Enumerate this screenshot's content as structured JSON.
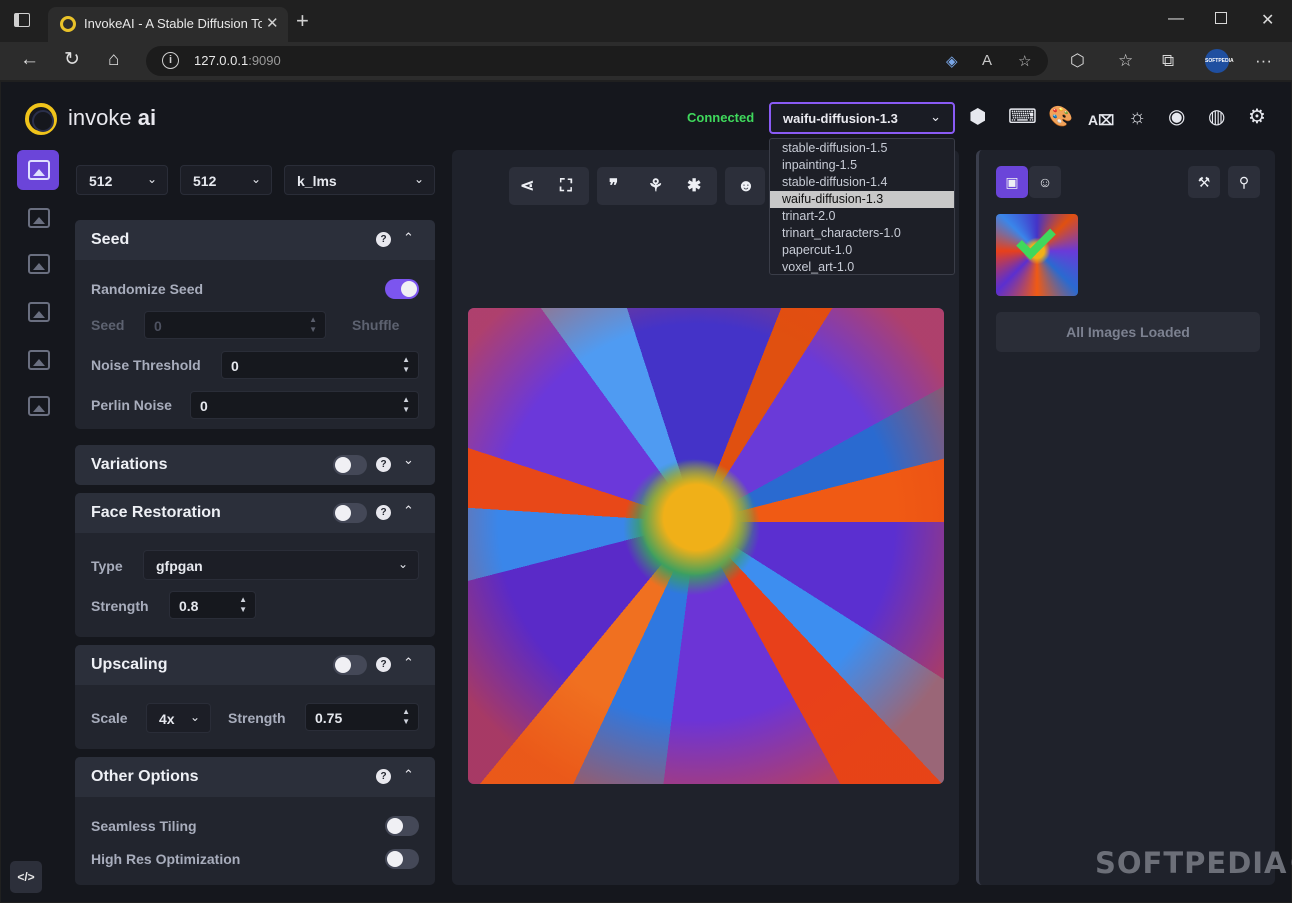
{
  "browser": {
    "tab_title": "InvokeAI - A Stable Diffusion Toolkit",
    "tab_close": "✕",
    "new_tab": "+",
    "url_host": "127.0.0.1",
    "url_port": ":9090",
    "profile_label": "SOFTPEDIA"
  },
  "header": {
    "logo_word1": "invoke",
    "logo_word2": "ai",
    "status": "Connected",
    "model_selected": "waifu-diffusion-1.3",
    "model_options": [
      "stable-diffusion-1.5",
      "inpainting-1.5",
      "stable-diffusion-1.4",
      "waifu-diffusion-1.3",
      "trinart-2.0",
      "trinart_characters-1.0",
      "papercut-1.0",
      "voxel_art-1.0"
    ],
    "status_color": "#3fd85c",
    "accent_color": "#7c55ef"
  },
  "top_selects": {
    "width": "512",
    "height": "512",
    "sampler": "k_lms"
  },
  "seed_panel": {
    "title": "Seed",
    "randomize_label": "Randomize Seed",
    "randomize_on": true,
    "seed_label": "Seed",
    "seed_value": "0",
    "shuffle_label": "Shuffle",
    "noise_label": "Noise Threshold",
    "noise_value": "0",
    "perlin_label": "Perlin Noise",
    "perlin_value": "0"
  },
  "variations_panel": {
    "title": "Variations",
    "enabled": false
  },
  "face_panel": {
    "title": "Face Restoration",
    "enabled": false,
    "type_label": "Type",
    "type_value": "gfpgan",
    "strength_label": "Strength",
    "strength_value": "0.8"
  },
  "upscaling_panel": {
    "title": "Upscaling",
    "enabled": false,
    "scale_label": "Scale",
    "scale_value": "4x",
    "strength_label": "Strength",
    "strength_value": "0.75"
  },
  "other_panel": {
    "title": "Other Options",
    "seamless_label": "Seamless Tiling",
    "seamless_on": false,
    "highres_label": "High Res Optimization",
    "highres_on": false
  },
  "gallery": {
    "all_loaded": "All Images Loaded"
  },
  "icons": {
    "help": "?",
    "chevron_up": "⌃",
    "chevron_down": "⌄",
    "dev": "</>"
  },
  "watermark": "SOFTPEDIA®"
}
